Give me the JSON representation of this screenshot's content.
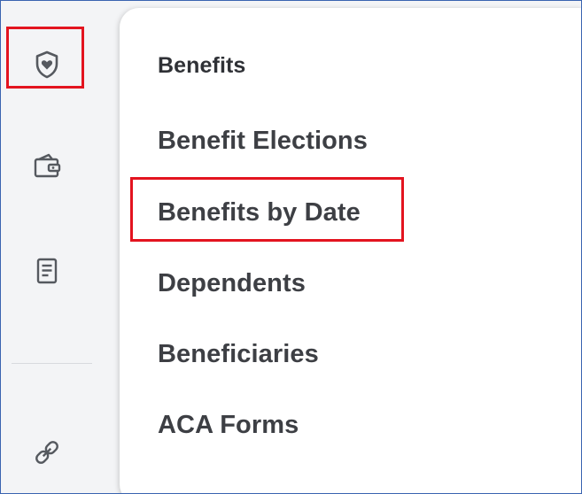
{
  "menu": {
    "header": "Benefits",
    "items": [
      {
        "label": "Benefit Elections"
      },
      {
        "label": "Benefits by Date"
      },
      {
        "label": "Dependents"
      },
      {
        "label": "Beneficiaries"
      },
      {
        "label": "ACA Forms"
      }
    ]
  },
  "rail": {
    "icons": [
      "shield-heart-icon",
      "wallet-icon",
      "document-icon",
      "link-icon"
    ]
  },
  "colors": {
    "highlight": "#e3141f",
    "frame_border": "#3a64b0",
    "rail_background": "#f3f4f6",
    "text": "#3d3f44"
  }
}
